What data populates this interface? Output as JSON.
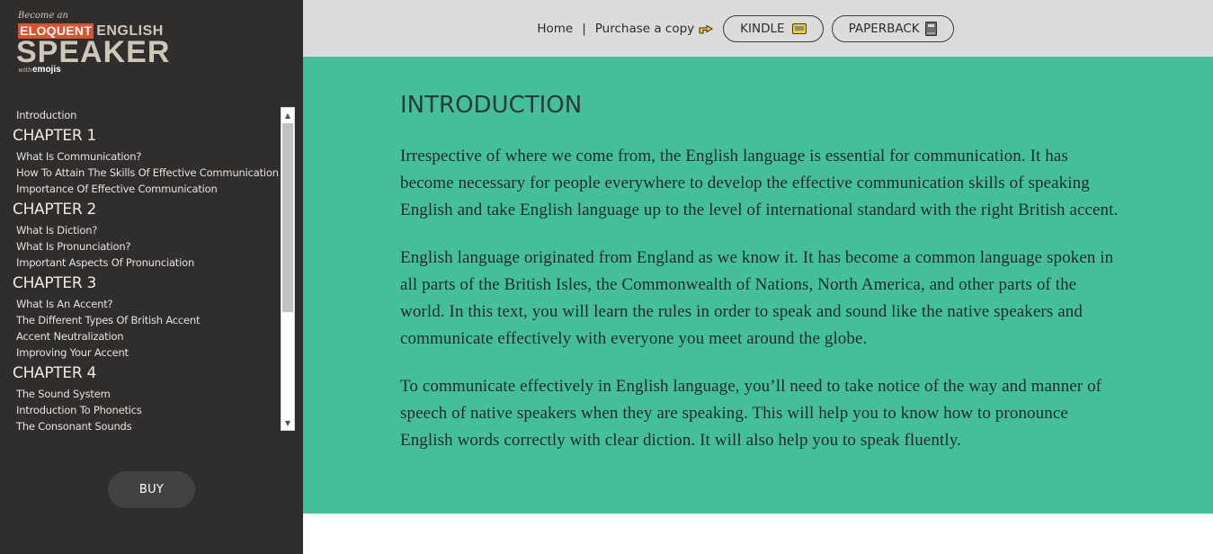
{
  "logo": {
    "tagline": "Become an",
    "word1": "ELOQUENT",
    "word2": "ENGLISH",
    "word3": "SPEAKER",
    "with": "with",
    "brand": "emojis"
  },
  "sidebar": {
    "toc": [
      {
        "type": "item",
        "label": "Introduction"
      },
      {
        "type": "chapter",
        "label": "CHAPTER 1"
      },
      {
        "type": "item",
        "label": "What Is Communication?"
      },
      {
        "type": "item",
        "label": "How To Attain The Skills Of Effective Communication"
      },
      {
        "type": "item",
        "label": "Importance Of Effective Communication"
      },
      {
        "type": "chapter",
        "label": "CHAPTER 2"
      },
      {
        "type": "item",
        "label": "What Is Diction?"
      },
      {
        "type": "item",
        "label": "What Is Pronunciation?"
      },
      {
        "type": "item",
        "label": "Important Aspects Of Pronunciation"
      },
      {
        "type": "chapter",
        "label": "CHAPTER 3"
      },
      {
        "type": "item",
        "label": "What Is An Accent?"
      },
      {
        "type": "item",
        "label": "The Different Types Of British Accent"
      },
      {
        "type": "item",
        "label": "Accent Neutralization"
      },
      {
        "type": "item",
        "label": "Improving Your Accent"
      },
      {
        "type": "chapter",
        "label": "CHAPTER 4"
      },
      {
        "type": "item",
        "label": "The Sound System"
      },
      {
        "type": "item",
        "label": "Introduction To Phonetics"
      },
      {
        "type": "item",
        "label": "The Consonant Sounds"
      }
    ],
    "buy_label": "BUY"
  },
  "topbar": {
    "home": "Home",
    "separator": "|",
    "purchase": "Purchase a copy",
    "kindle": "KINDLE",
    "paperback": "PAPERBACK"
  },
  "icons": {
    "purchase": "pointing-hand-icon",
    "kindle": "kindle-icon",
    "paperback": "book-icon"
  },
  "colors": {
    "sidebar_bg": "#2f2e2d",
    "topbar_bg": "#dcdcdc",
    "content_bg": "#45bf99",
    "logo_accent": "#d9532c"
  },
  "main": {
    "title": "INTRODUCTION",
    "paragraphs": [
      "Irrespective of where we come from, the English language is essential for communication. It has become necessary for people everywhere to develop the effective communication skills of speaking English and take English language up to the level of international standard with the right British accent.",
      "English language originated from England as we know it. It has become a common language spoken in all parts of the British Isles, the Commonwealth of Nations, North America, and other parts of the world. In this text, you will learn the rules in order to speak and sound like the native speakers and communicate effectively with everyone you meet around the globe.",
      "To communicate effectively in English language, you’ll need to take notice of the way and manner of speech of native speakers when they are speaking. This will help you to know how to pronounce English words correctly with clear diction. It will also help you to speak fluently."
    ]
  }
}
